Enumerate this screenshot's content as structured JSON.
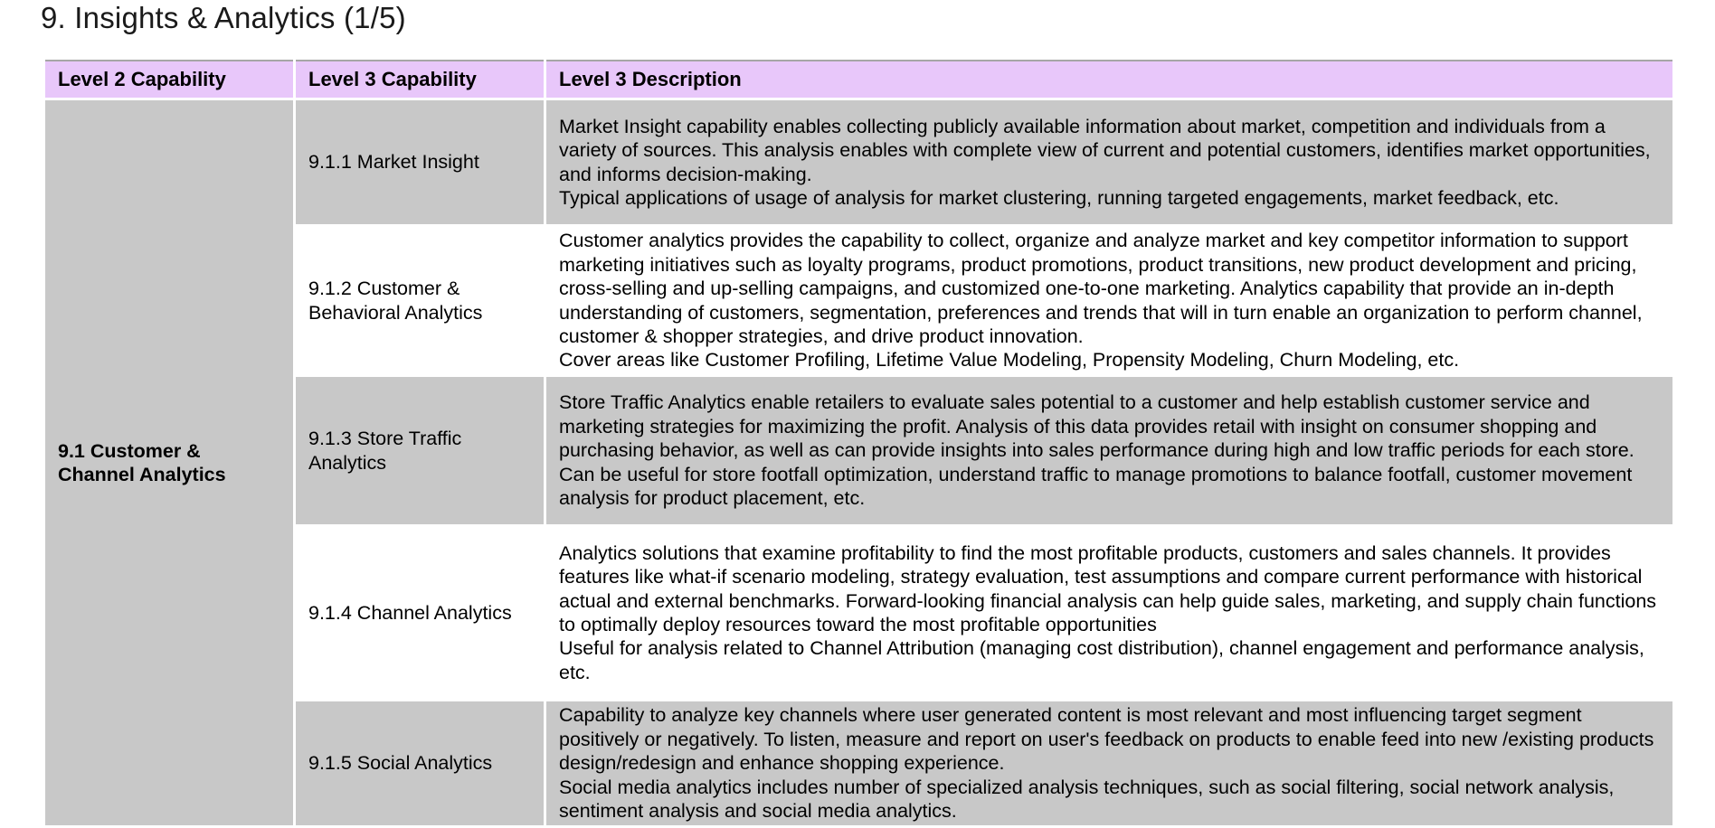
{
  "page": {
    "title": "9. Insights & Analytics (1/5)"
  },
  "table": {
    "headers": [
      "Level 2 Capability",
      "Level 3 Capability",
      "Level 3 Description"
    ],
    "level2": "9.1 Customer & Channel Analytics",
    "rows": [
      {
        "level3": "9.1.1 Market Insight",
        "description": [
          "Market Insight capability enables collecting publicly available information about market, competition and individuals from a variety of sources. This analysis enables with complete view of current and potential customers, identifies market opportunities, and informs decision-making.",
          "Typical applications of usage of analysis for market clustering, running targeted engagements, market feedback, etc."
        ]
      },
      {
        "level3": "9.1.2 Customer & Behavioral Analytics",
        "description": [
          "Customer analytics provides the capability to collect, organize and analyze market and key competitor information to support marketing initiatives such as loyalty programs, product promotions, product transitions, new product development and pricing, cross-selling and up-selling campaigns, and customized one-to-one marketing. Analytics capability that provide an in-depth understanding of customers, segmentation, preferences and trends that will in turn enable an organization to perform channel, customer & shopper strategies, and drive product innovation.",
          "Cover areas like Customer Profiling, Lifetime Value Modeling, Propensity Modeling, Churn Modeling, etc."
        ]
      },
      {
        "level3": "9.1.3 Store Traffic Analytics",
        "description": [
          "Store Traffic Analytics enable retailers to evaluate sales potential to a customer and help establish customer service and marketing strategies for maximizing the profit. Analysis of this data provides retail with insight on consumer shopping and purchasing behavior, as well as can provide insights into sales performance during high and low traffic periods for each store.",
          "Can be useful for store footfall optimization, understand traffic to manage promotions to balance footfall, customer movement analysis for product placement, etc."
        ]
      },
      {
        "level3": "9.1.4 Channel Analytics",
        "description": [
          "Analytics solutions that examine profitability to find the most profitable products, customers and sales channels. It provides features like what-if scenario modeling, strategy evaluation, test assumptions and compare current performance with historical actual and external benchmarks. Forward-looking financial analysis can help guide sales, marketing, and supply chain functions to optimally deploy resources toward the most profitable opportunities",
          "Useful for analysis related to Channel Attribution (managing cost distribution), channel engagement and performance analysis, etc."
        ]
      },
      {
        "level3": "9.1.5 Social Analytics",
        "description": [
          "Capability to analyze key channels where user generated content is most relevant and most influencing target segment positively or negatively. To listen, measure and report on user's feedback on products to enable feed into new /existing products design/redesign and enhance shopping experience.",
          "Social media analytics includes number of specialized analysis techniques, such as social filtering, social network analysis, sentiment analysis and social media analytics."
        ]
      }
    ]
  },
  "colors": {
    "header_bg": "#e8c7fa",
    "shaded_row_bg": "#c8c8c8",
    "plain_row_bg": "#ffffff",
    "border": "#a6a6a6"
  }
}
